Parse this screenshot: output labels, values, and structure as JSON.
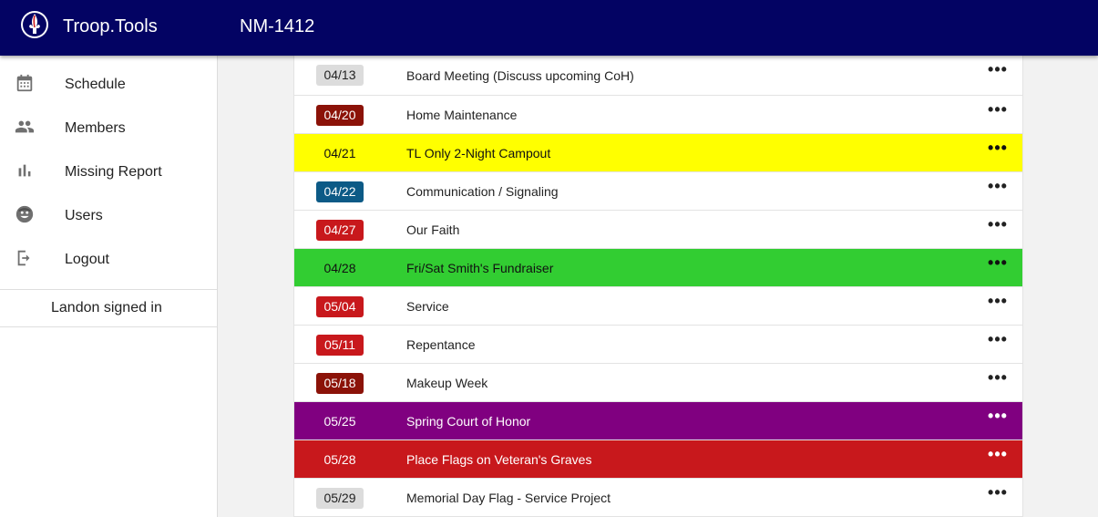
{
  "header": {
    "app_title": "Troop.Tools",
    "unit_title": "NM-1412",
    "background": "#030363"
  },
  "sidebar": {
    "items": [
      {
        "label": "Schedule",
        "icon": "calendar-icon"
      },
      {
        "label": "Members",
        "icon": "people-icon"
      },
      {
        "label": "Missing Report",
        "icon": "bar-chart-icon"
      },
      {
        "label": "Users",
        "icon": "face-icon"
      },
      {
        "label": "Logout",
        "icon": "logout-icon"
      }
    ],
    "signed_in": "Landon signed in"
  },
  "events": [
    {
      "date": "04/13",
      "title": "Board Meeting (Discuss upcoming CoH)",
      "row_bg": "#ffffff",
      "badge_bg": "#dcdcdc",
      "badge_fg": "#222222",
      "row_fg": "#222222"
    },
    {
      "date": "04/20",
      "title": "Home Maintenance",
      "row_bg": "#ffffff",
      "badge_bg": "#8b1208",
      "badge_fg": "#ffffff",
      "row_fg": "#222222"
    },
    {
      "date": "04/21",
      "title": "TL Only 2-Night Campout",
      "row_bg": "#ffff00",
      "badge_bg": "transparent",
      "badge_fg": "#111111",
      "row_fg": "#111111"
    },
    {
      "date": "04/22",
      "title": "Communication / Signaling",
      "row_bg": "#ffffff",
      "badge_bg": "#0c5a86",
      "badge_fg": "#ffffff",
      "row_fg": "#222222"
    },
    {
      "date": "04/27",
      "title": "Our Faith",
      "row_bg": "#ffffff",
      "badge_bg": "#c8181c",
      "badge_fg": "#ffffff",
      "row_fg": "#222222"
    },
    {
      "date": "04/28",
      "title": "Fri/Sat Smith's Fundraiser",
      "row_bg": "#32cd32",
      "badge_bg": "transparent",
      "badge_fg": "#111111",
      "row_fg": "#111111"
    },
    {
      "date": "05/04",
      "title": "Service",
      "row_bg": "#ffffff",
      "badge_bg": "#c8181c",
      "badge_fg": "#ffffff",
      "row_fg": "#222222"
    },
    {
      "date": "05/11",
      "title": "Repentance",
      "row_bg": "#ffffff",
      "badge_bg": "#c8181c",
      "badge_fg": "#ffffff",
      "row_fg": "#222222"
    },
    {
      "date": "05/18",
      "title": "Makeup Week",
      "row_bg": "#ffffff",
      "badge_bg": "#8b1208",
      "badge_fg": "#ffffff",
      "row_fg": "#222222"
    },
    {
      "date": "05/25",
      "title": "Spring Court of Honor",
      "row_bg": "#800080",
      "badge_bg": "transparent",
      "badge_fg": "#ffffff",
      "row_fg": "#ffffff"
    },
    {
      "date": "05/28",
      "title": "Place Flags on Veteran's Graves",
      "row_bg": "#c8181c",
      "badge_bg": "transparent",
      "badge_fg": "#ffffff",
      "row_fg": "#ffffff"
    },
    {
      "date": "05/29",
      "title": "Memorial Day Flag - Service Project",
      "row_bg": "#ffffff",
      "badge_bg": "#dcdcdc",
      "badge_fg": "#222222",
      "row_fg": "#222222"
    }
  ],
  "more_label": "•••"
}
